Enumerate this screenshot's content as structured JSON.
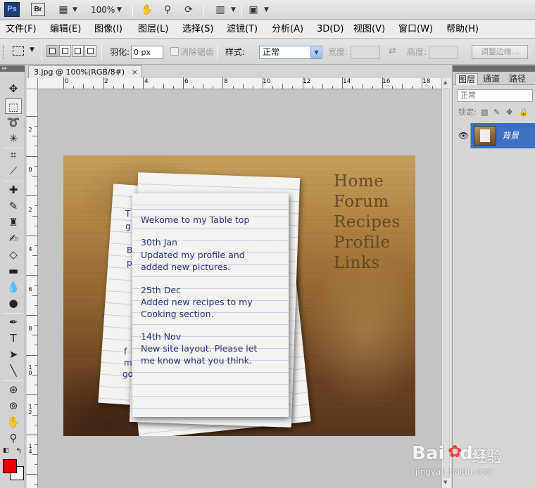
{
  "appbar": {
    "ps_logo": "Ps",
    "br_logo": "Br",
    "zoom": "100%"
  },
  "menu": [
    {
      "label": "文件(F)"
    },
    {
      "label": "编辑(E)"
    },
    {
      "label": "图像(I)"
    },
    {
      "label": "图层(L)"
    },
    {
      "label": "选择(S)"
    },
    {
      "label": "滤镜(T)"
    },
    {
      "label": "分析(A)"
    },
    {
      "label": "3D(D)"
    },
    {
      "label": "视图(V)"
    },
    {
      "label": "窗口(W)"
    },
    {
      "label": "帮助(H)"
    }
  ],
  "options": {
    "feather_label": "羽化:",
    "feather_value": "0 px",
    "antialias_label": "消除锯齿",
    "style_label": "样式:",
    "style_value": "正常",
    "width_label": "宽度:",
    "height_label": "高度:",
    "refine_label": "调整边缘..."
  },
  "document": {
    "tab_title": "3.jpg @ 100%(RGB/8#)",
    "close": "×",
    "ruler_h": [
      "0",
      "2",
      "4",
      "6",
      "8",
      "10",
      "12",
      "14",
      "16",
      "18"
    ],
    "ruler_v": [
      "2",
      "0",
      "2",
      "4",
      "6",
      "8",
      "1 0",
      "1 2",
      "1 4"
    ]
  },
  "canvas": {
    "note_heading": "Wekome to my Table top",
    "entries": [
      {
        "date": "30th Jan",
        "text": "Updated my profile and\nadded new pictures."
      },
      {
        "date": "25th Dec",
        "text": "Added new recipes to my\nCooking section."
      },
      {
        "date": "14th Nov",
        "text": "New site layout. Please let\nme know what you think."
      }
    ],
    "nav": [
      "Home",
      "Forum",
      "Recipes",
      "Profile",
      "Links"
    ]
  },
  "layers_panel": {
    "tabs": [
      "图层",
      "通道",
      "路径"
    ],
    "blend_mode": "正常",
    "lock_label": "锁定:",
    "layer_name": "背景"
  },
  "watermark": {
    "brand": "Bai",
    "brand_end": "du",
    "cn": "经验",
    "url": "jingyan.baidu.com"
  }
}
